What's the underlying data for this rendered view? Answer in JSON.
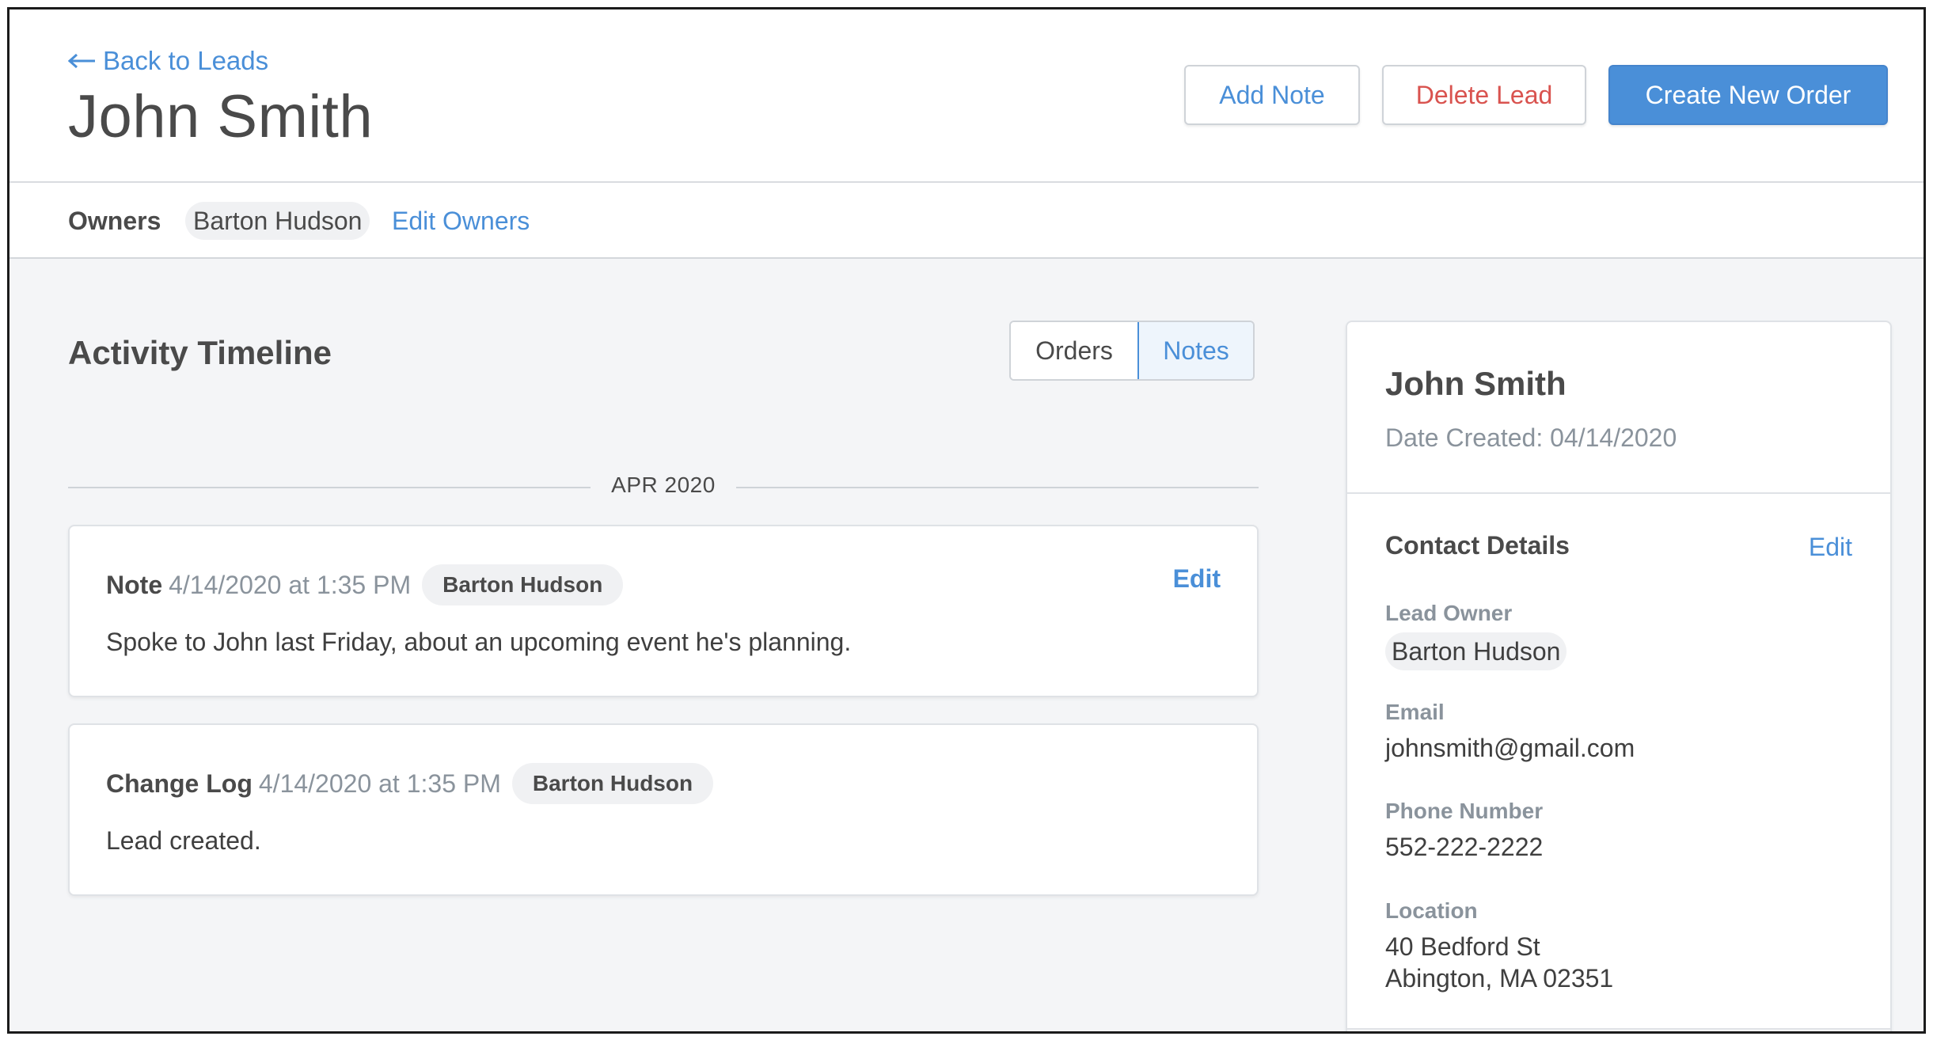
{
  "header": {
    "back_label": "Back to Leads",
    "title": "John Smith",
    "buttons": {
      "add_note": "Add Note",
      "delete_lead": "Delete Lead",
      "create_order": "Create New Order"
    }
  },
  "owners": {
    "label": "Owners",
    "owner": "Barton Hudson",
    "edit_label": "Edit Owners"
  },
  "activity": {
    "title": "Activity Timeline",
    "tabs": [
      "Orders",
      "Notes"
    ],
    "active_tab": "Notes",
    "month_divider": "APR 2020",
    "entries": [
      {
        "kind": "Note",
        "time": "4/14/2020 at 1:35 PM",
        "author": "Barton Hudson",
        "body": "Spoke to John last Friday, about an upcoming event he's planning.",
        "edit_label": "Edit"
      },
      {
        "kind": "Change Log",
        "time": "4/14/2020 at 1:35 PM",
        "author": "Barton Hudson",
        "body": "Lead created."
      }
    ]
  },
  "side": {
    "name": "John Smith",
    "date_created": "Date Created: 04/14/2020",
    "contact_title": "Contact Details",
    "contact_edit": "Edit",
    "lead_owner_label": "Lead Owner",
    "lead_owner": "Barton Hudson",
    "email_label": "Email",
    "email": "johnsmith@gmail.com",
    "phone_label": "Phone Number",
    "phone": "552-222-2222",
    "location_label": "Location",
    "location_line1": "40 Bedford St",
    "location_line2": "Abington, MA 02351"
  },
  "colors": {
    "accent": "#4a8fd8",
    "danger": "#d9534f",
    "page_bg": "#f4f5f7",
    "muted_text": "#8a939c"
  },
  "icons": {
    "back": "arrow-left-icon"
  }
}
